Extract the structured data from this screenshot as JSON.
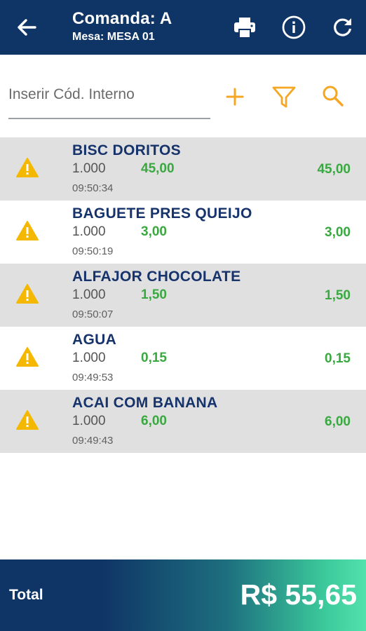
{
  "header": {
    "title": "Comanda: A",
    "subtitle": "Mesa: MESA 01",
    "back_icon": "arrow-left-icon",
    "print_icon": "printer-icon",
    "info_icon": "info-icon",
    "refresh_icon": "refresh-icon",
    "background_color": "#0f3566"
  },
  "search": {
    "placeholder": "Inserir Cód. Interno",
    "value": "",
    "add_icon": "plus-icon",
    "filter_icon": "filter-icon",
    "search_icon": "search-icon",
    "accent_color": "#f5a623"
  },
  "items": [
    {
      "name": "BISC DORITOS",
      "qty": "1.000",
      "unit_price": "45,00",
      "line_total": "45,00",
      "time": "09:50:34",
      "icon": "warning-icon"
    },
    {
      "name": "BAGUETE PRES QUEIJO",
      "qty": "1.000",
      "unit_price": "3,00",
      "line_total": "3,00",
      "time": "09:50:19",
      "icon": "warning-icon"
    },
    {
      "name": "ALFAJOR CHOCOLATE",
      "qty": "1.000",
      "unit_price": "1,50",
      "line_total": "1,50",
      "time": "09:50:07",
      "icon": "warning-icon"
    },
    {
      "name": "AGUA",
      "qty": "1.000",
      "unit_price": "0,15",
      "line_total": "0,15",
      "time": "09:49:53",
      "icon": "warning-icon"
    },
    {
      "name": "ACAI COM BANANA",
      "qty": "1.000",
      "unit_price": "6,00",
      "line_total": "6,00",
      "time": "09:49:43",
      "icon": "warning-icon"
    }
  ],
  "footer": {
    "label": "Total",
    "total": "R$ 55,65"
  },
  "colors": {
    "price_green": "#3aa841",
    "item_name": "#17336b",
    "warning": "#f5b800"
  }
}
